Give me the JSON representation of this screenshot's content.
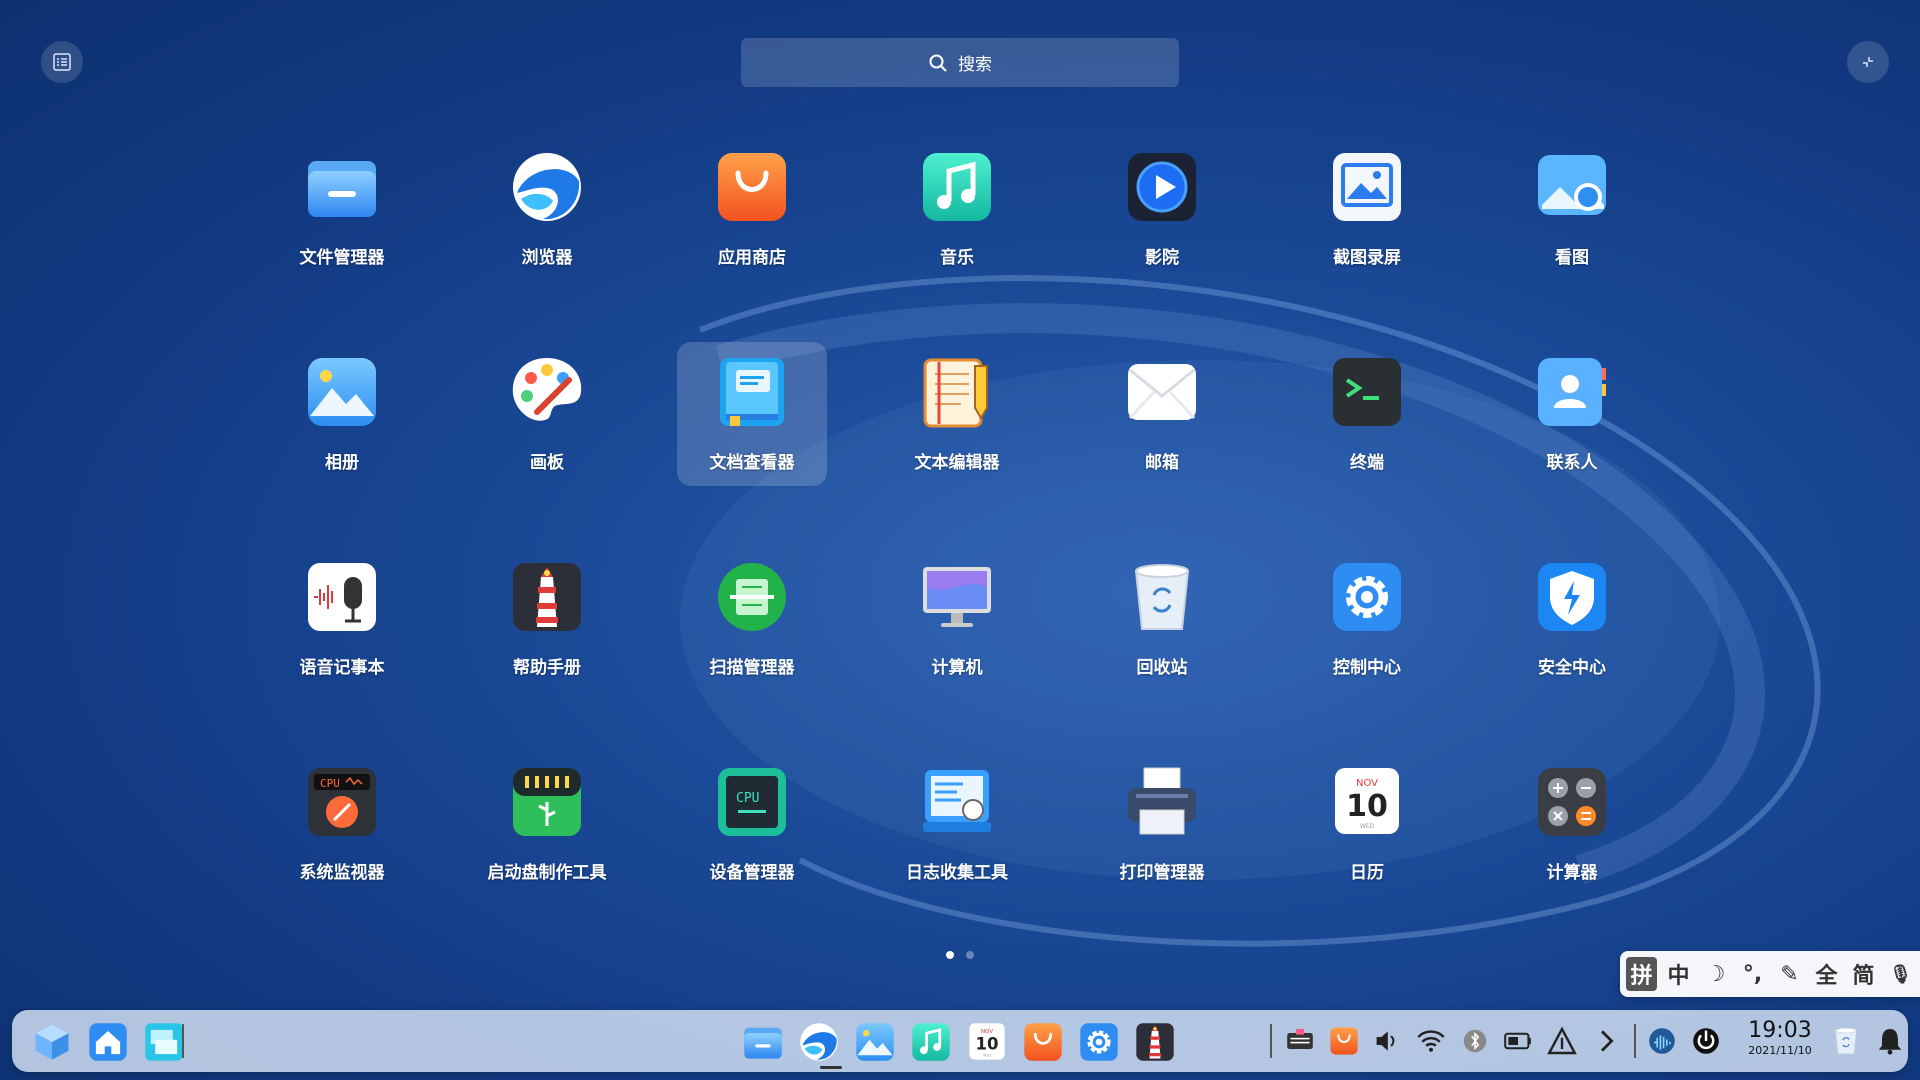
{
  "search": {
    "label": "搜索"
  },
  "apps": [
    {
      "label": "文件管理器",
      "icon": "folder-icon"
    },
    {
      "label": "浏览器",
      "icon": "browser-icon"
    },
    {
      "label": "应用商店",
      "icon": "store-bag-icon"
    },
    {
      "label": "音乐",
      "icon": "music-note-icon"
    },
    {
      "label": "影院",
      "icon": "play-icon"
    },
    {
      "label": "截图录屏",
      "icon": "screenshot-icon"
    },
    {
      "label": "看图",
      "icon": "image-viewer-icon"
    },
    {
      "label": "相册",
      "icon": "album-icon"
    },
    {
      "label": "画板",
      "icon": "palette-icon"
    },
    {
      "label": "文档查看器",
      "icon": "document-viewer-icon"
    },
    {
      "label": "文本编辑器",
      "icon": "text-editor-icon"
    },
    {
      "label": "邮箱",
      "icon": "mail-icon"
    },
    {
      "label": "终端",
      "icon": "terminal-icon"
    },
    {
      "label": "联系人",
      "icon": "contacts-icon"
    },
    {
      "label": "语音记事本",
      "icon": "voice-note-icon"
    },
    {
      "label": "帮助手册",
      "icon": "lighthouse-icon"
    },
    {
      "label": "扫描管理器",
      "icon": "scanner-icon"
    },
    {
      "label": "计算机",
      "icon": "computer-icon"
    },
    {
      "label": "回收站",
      "icon": "trash-icon"
    },
    {
      "label": "控制中心",
      "icon": "gear-icon"
    },
    {
      "label": "安全中心",
      "icon": "shield-icon"
    },
    {
      "label": "系统监视器",
      "icon": "system-monitor-icon"
    },
    {
      "label": "启动盘制作工具",
      "icon": "usb-icon"
    },
    {
      "label": "设备管理器",
      "icon": "cpu-icon"
    },
    {
      "label": "日志收集工具",
      "icon": "log-icon"
    },
    {
      "label": "打印管理器",
      "icon": "printer-icon"
    },
    {
      "label": "日历",
      "icon": "calendar-icon"
    },
    {
      "label": "计算器",
      "icon": "calculator-icon"
    }
  ],
  "selected_app": "文档查看器",
  "pages": {
    "current": 1,
    "total": 2
  },
  "ime": {
    "items": [
      "拼",
      "中",
      "☽",
      "°,",
      "✎",
      "全",
      "简",
      "🎙"
    ]
  },
  "calendar_icon": {
    "month": "NOV",
    "day": "10",
    "weekday": "WED"
  },
  "cpu_icon_text": "CPU",
  "clock": {
    "time": "19:03",
    "date": "2021/11/10"
  },
  "dock": {
    "left": [
      "launcher-icon",
      "home-icon",
      "multitask-icon"
    ],
    "center": [
      "folder-icon",
      "browser-icon",
      "album-icon",
      "music-note-icon",
      "calendar-icon",
      "store-bag-icon",
      "gear-icon",
      "lighthouse-icon"
    ],
    "tray": [
      "keyboard-icon",
      "store-bag-icon",
      "volume-icon",
      "wifi-icon",
      "bluetooth-icon",
      "battery-icon",
      "screen-record-icon",
      "chevron-right-icon",
      "voice-assistant-icon",
      "power-icon",
      "trash-icon",
      "bell-icon"
    ]
  }
}
